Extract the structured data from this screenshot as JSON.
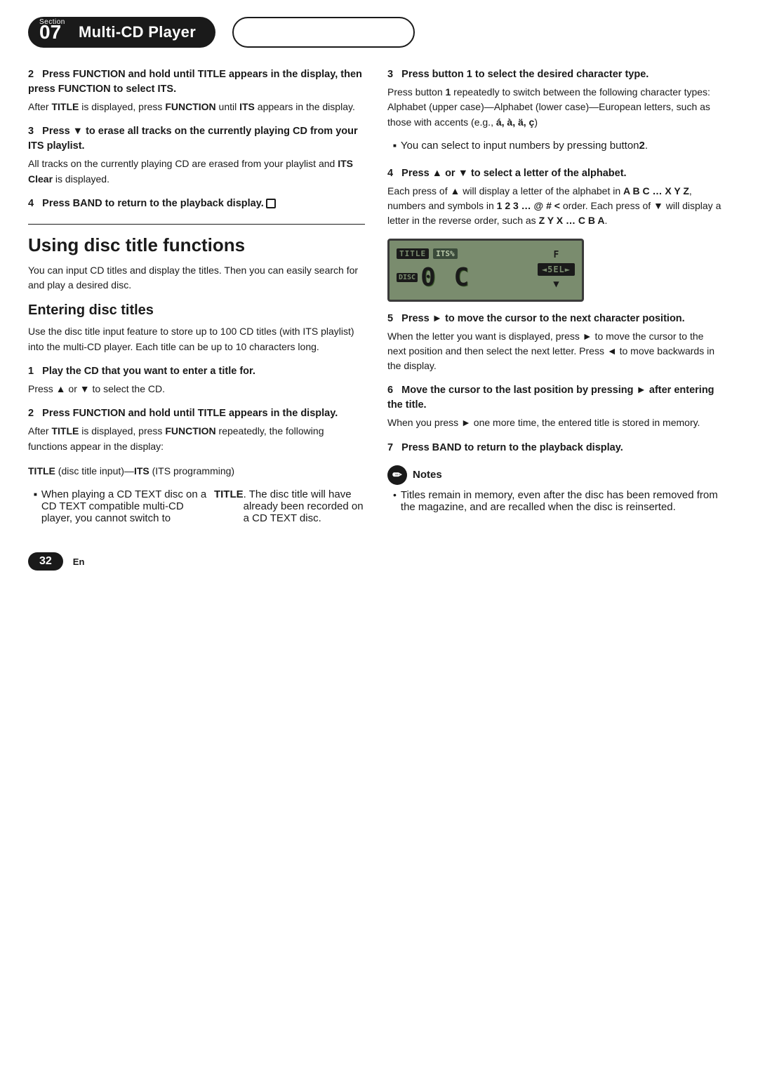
{
  "header": {
    "section_label": "Section",
    "section_number": "07",
    "title": "Multi-CD Player",
    "right_box_text": ""
  },
  "left_col": {
    "step2_heading": "2   Press FUNCTION and hold until TITLE appears in the display, then press FUNCTION to select ITS.",
    "step2_body_1": "After ",
    "step2_body_bold1": "TITLE",
    "step2_body_2": " is displayed, press ",
    "step2_body_bold2": "FUNCTION",
    "step2_body_3": " until ",
    "step2_body_bold3": "ITS",
    "step2_body_4": " appears in the display.",
    "step3_heading": "3   Press ▼ to erase all tracks on the currently playing CD from your ITS playlist.",
    "step3_body": "All tracks on the currently playing CD are erased from your playlist and ",
    "step3_body_bold": "ITS Clear",
    "step3_body2": " is displayed.",
    "step4_heading": "4   Press BAND to return to the playback display.",
    "section_title_large": "Using disc title functions",
    "section_intro": "You can input CD titles and display the titles. Then you can easily search for and play a desired disc.",
    "sub_title": "Entering disc titles",
    "sub_intro": "Use the disc title input feature to store up to 100 CD titles  (with ITS playlist) into the multi-CD player. Each title can be up to 10 characters long.",
    "play_heading": "1   Play the CD that you want to enter a title for.",
    "play_body": "Press ▲ or ▼ to select the CD.",
    "press_func_heading": "2   Press FUNCTION and hold until TITLE appears in the display.",
    "press_func_body_pre": "After ",
    "press_func_body_bold1": "TITLE",
    "press_func_body_mid": " is displayed, press ",
    "press_func_body_bold2": "FUNCTION",
    "press_func_body_post": " repeatedly, the following functions appear in the display:",
    "title_its_line": "TITLE",
    "title_its_line_bold": " (disc title input)—",
    "its_label": "ITS",
    "its_desc": " (ITS programming)",
    "bullet_cd_text": "When playing a CD TEXT disc on a CD TEXT compatible multi-CD player, you cannot switch to ",
    "bullet_cd_bold": "TITLE",
    "bullet_cd_post": ". The disc title will have already been recorded on a CD TEXT disc."
  },
  "right_col": {
    "step3r_heading": "3   Press button 1 to select the desired character type.",
    "step3r_body1": "Press button ",
    "step3r_body_bold1": "1",
    "step3r_body2": " repeatedly to switch between the following character types:",
    "step3r_body3": "Alphabet (upper case)—Alphabet (lower case)—European letters, such as those with accents (e.g., ",
    "step3r_accent": "á, à, ä, ç",
    "step3r_body4": ")",
    "step3r_bullet": "You can select to input numbers by pressing button ",
    "step3r_bullet_bold": "2",
    "step3r_bullet_end": ".",
    "step4r_heading": "4   Press ▲ or ▼ to select a letter of the alphabet.",
    "step4r_body1": "Each press of ▲ will display a letter of the alphabet in ",
    "step4r_bold1": "A B C … X Y Z",
    "step4r_body2": ", numbers and symbols in ",
    "step4r_bold2": "1 2 3 … @ # <",
    "step4r_body3": " order. Each press of ▼ will display a letter in the reverse order, such as ",
    "step4r_bold3": "Z Y X … C B A",
    "step4r_body4": ".",
    "lcd_title": "TITLE",
    "lcd_its": "ITS%",
    "lcd_disc": "DISC",
    "lcd_chars": "0  C",
    "lcd_f": "F",
    "lcd_sel": "◄5EL►",
    "lcd_arrow": "▼",
    "step5r_heading": "5   Press ► to move the cursor to the next character position.",
    "step5r_body1": "When the letter you want is displayed, press ► to move the cursor to the next position and then select the next letter. Press ◄ to move backwards in the display.",
    "step6r_heading": "6   Move the cursor to the last position by pressing ► after entering the title.",
    "step6r_body": "When you press ► one more time, the entered title is stored in memory.",
    "step7r_heading": "7   Press BAND to return to the playback display.",
    "notes_title": "Notes",
    "notes_bullet": "Titles remain in memory, even after the disc has been removed from the magazine, and are recalled when the disc is reinserted."
  },
  "footer": {
    "page_number": "32",
    "lang": "En"
  }
}
